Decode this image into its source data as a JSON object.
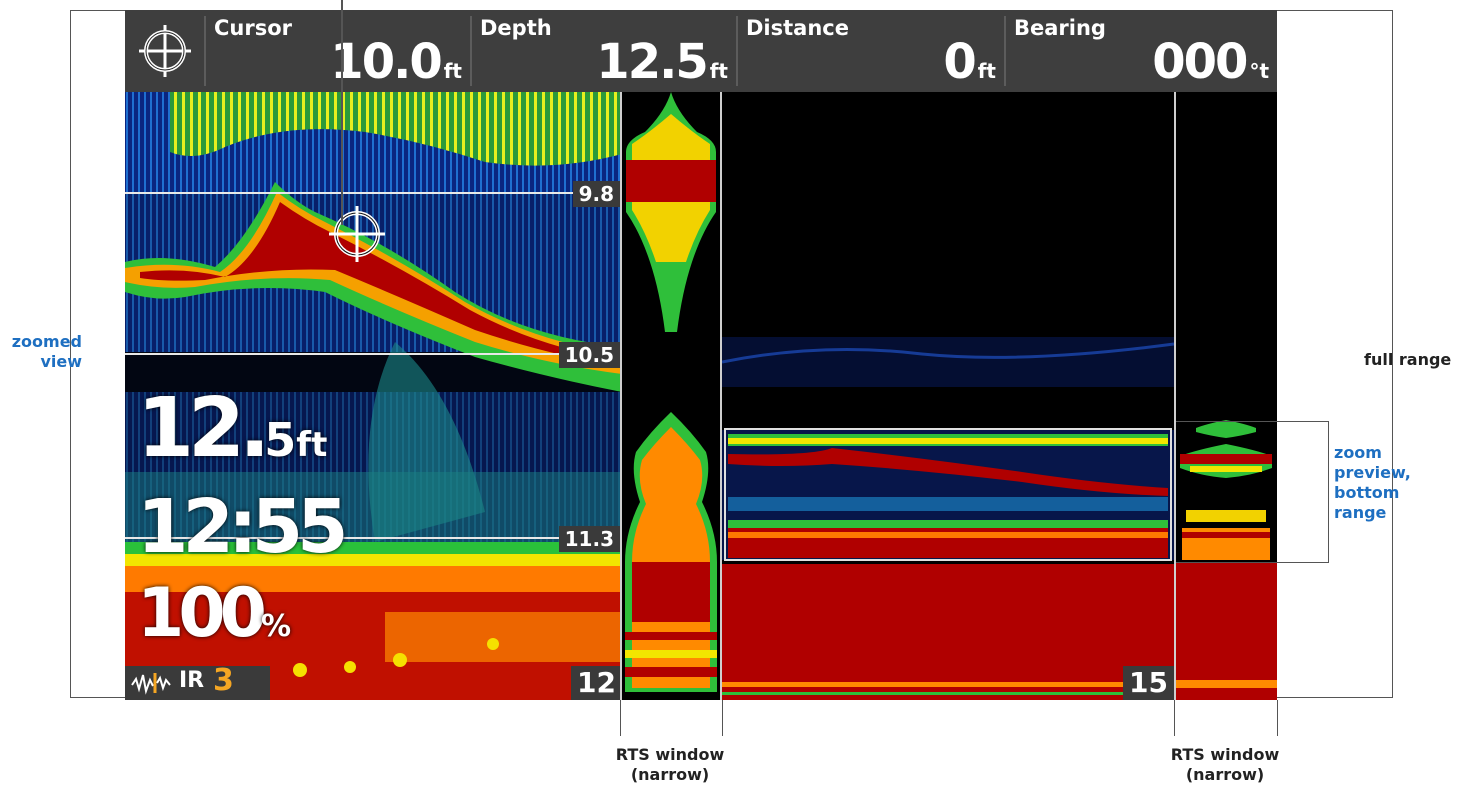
{
  "header": {
    "cursor": {
      "label": "Cursor",
      "value": "10.0",
      "unit": "ft"
    },
    "depth": {
      "label": "Depth",
      "value": "12.5",
      "unit": "ft"
    },
    "distance": {
      "label": "Distance",
      "value": "0",
      "unit": "ft"
    },
    "bearing": {
      "label": "Bearing",
      "value": "000",
      "unit": "°t"
    }
  },
  "left_panel": {
    "depth_tags": [
      "9.8",
      "10.5",
      "11.3"
    ],
    "bottom_scale": "12",
    "digital_depth": {
      "value": "12.",
      "decimal": "5",
      "unit": "ft"
    },
    "time": "12:55",
    "battery": {
      "value": "100",
      "unit": "%"
    },
    "mode": {
      "label": "IR",
      "level": "3"
    }
  },
  "right_panel": {
    "bottom_scale": "15"
  },
  "annotations": {
    "zoomed_view": "zoomed view",
    "full_range": "full range",
    "zoom_preview": "zoom preview, bottom range",
    "rts_left": "RTS window (narrow)",
    "rts_right": "RTS window (narrow)"
  },
  "colors": {
    "sonar_red": "#b00000",
    "sonar_orange": "#ff7a00",
    "sonar_yellow": "#f2f200",
    "sonar_green": "#3ccf3c",
    "sonar_blue": "#0b2a8a",
    "annotation_blue": "#1e6fc1",
    "mode_accent": "#f5a623"
  }
}
